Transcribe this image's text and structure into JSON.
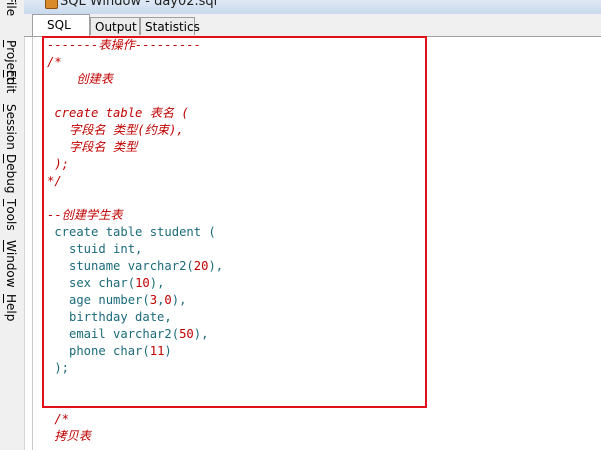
{
  "window": {
    "title": "SQL Window - day02.sql"
  },
  "menu": {
    "items": [
      {
        "label": "File",
        "underline": "",
        "key": "file"
      },
      {
        "label": "Project",
        "underline": "P",
        "key": "project"
      },
      {
        "label": "Edit",
        "underline": "E",
        "key": "edit"
      },
      {
        "label": "Session",
        "underline": "S",
        "key": "session"
      },
      {
        "label": "Debug",
        "underline": "D",
        "key": "debug"
      },
      {
        "label": "Tools",
        "underline": "T",
        "key": "tools"
      },
      {
        "label": "Window",
        "underline": "W",
        "key": "window"
      },
      {
        "label": "Help",
        "underline": "H",
        "key": "help"
      }
    ]
  },
  "tabs": [
    {
      "label": "SQL",
      "active": true
    },
    {
      "label": "Output",
      "active": false
    },
    {
      "label": "Statistics",
      "active": false
    }
  ],
  "editor": {
    "lines": [
      {
        "indent": "",
        "segments": [
          {
            "t": "-------表操作---------",
            "c": "comment"
          }
        ]
      },
      {
        "indent": "",
        "segments": [
          {
            "t": "/*",
            "c": "comment"
          }
        ]
      },
      {
        "indent": "",
        "segments": [
          {
            "t": "    创建表",
            "c": "comment"
          }
        ]
      },
      {
        "indent": "",
        "segments": [
          {
            "t": "",
            "c": "comment"
          }
        ]
      },
      {
        "indent": "",
        "segments": [
          {
            "t": " create table 表名 (",
            "c": "comment"
          }
        ]
      },
      {
        "indent": "",
        "segments": [
          {
            "t": "   字段名 类型(约束),",
            "c": "comment"
          }
        ]
      },
      {
        "indent": "",
        "segments": [
          {
            "t": "   字段名 类型",
            "c": "comment"
          }
        ]
      },
      {
        "indent": "",
        "segments": [
          {
            "t": " );",
            "c": "comment"
          }
        ]
      },
      {
        "indent": "",
        "segments": [
          {
            "t": "*/",
            "c": "comment"
          }
        ]
      },
      {
        "indent": "",
        "segments": [
          {
            "t": "",
            "c": "comment"
          }
        ]
      },
      {
        "indent": "",
        "segments": [
          {
            "t": "--创建学生表",
            "c": "comment"
          }
        ]
      },
      {
        "indent": "",
        "segments": [
          {
            "t": " create table student (",
            "c": "kw"
          }
        ]
      },
      {
        "indent": "",
        "segments": [
          {
            "t": "   stuid int,",
            "c": "kw"
          }
        ]
      },
      {
        "indent": "",
        "segments": [
          {
            "t": "   stuname varchar2(",
            "c": "kw"
          },
          {
            "t": "20",
            "c": "num"
          },
          {
            "t": "),",
            "c": "kw"
          }
        ]
      },
      {
        "indent": "",
        "segments": [
          {
            "t": "   sex char(",
            "c": "kw"
          },
          {
            "t": "10",
            "c": "num"
          },
          {
            "t": "),",
            "c": "kw"
          }
        ]
      },
      {
        "indent": "",
        "segments": [
          {
            "t": "   age number(",
            "c": "kw"
          },
          {
            "t": "3",
            "c": "num"
          },
          {
            "t": ",",
            "c": "kw"
          },
          {
            "t": "0",
            "c": "num"
          },
          {
            "t": "),",
            "c": "kw"
          }
        ]
      },
      {
        "indent": "",
        "segments": [
          {
            "t": "   birthday date,",
            "c": "kw"
          }
        ]
      },
      {
        "indent": "",
        "segments": [
          {
            "t": "   email varchar2(",
            "c": "kw"
          },
          {
            "t": "50",
            "c": "num"
          },
          {
            "t": "),",
            "c": "kw"
          }
        ]
      },
      {
        "indent": "",
        "segments": [
          {
            "t": "   phone char(",
            "c": "kw"
          },
          {
            "t": "11",
            "c": "num"
          },
          {
            "t": ")",
            "c": "kw"
          }
        ]
      },
      {
        "indent": "",
        "segments": [
          {
            "t": " );",
            "c": "kw"
          }
        ]
      },
      {
        "indent": "",
        "segments": [
          {
            "t": "",
            "c": "comment"
          }
        ]
      },
      {
        "indent": "",
        "segments": [
          {
            "t": "",
            "c": "comment"
          }
        ]
      },
      {
        "indent": "",
        "segments": [
          {
            "t": " /*",
            "c": "comment"
          }
        ]
      },
      {
        "indent": "",
        "segments": [
          {
            "t": " 拷贝表",
            "c": "comment"
          }
        ]
      }
    ]
  },
  "colors": {
    "comment": "#c00000",
    "keyword": "#1b6b7a",
    "highlight": "#e0101a"
  }
}
